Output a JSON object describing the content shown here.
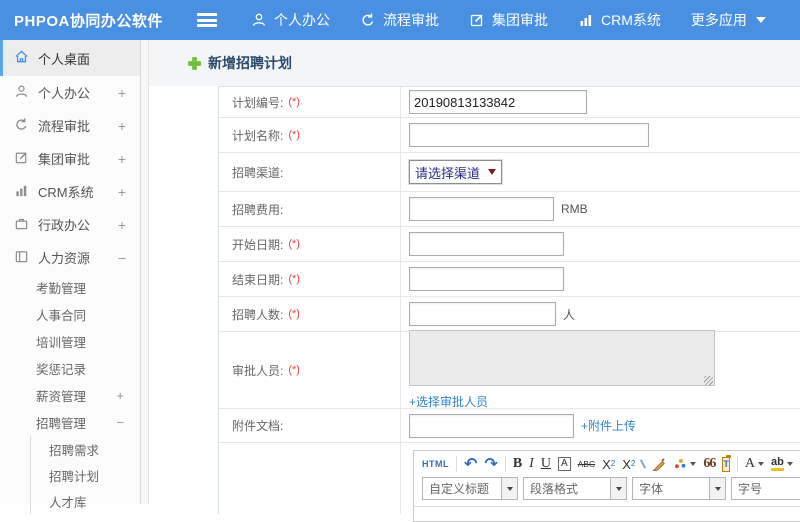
{
  "topbar": {
    "logo": "PHPOA协同办公软件",
    "items": [
      {
        "label": "个人办公",
        "icon": "person-icon"
      },
      {
        "label": "流程审批",
        "icon": "process-icon"
      },
      {
        "label": "集团审批",
        "icon": "edit-icon"
      },
      {
        "label": "CRM系统",
        "icon": "chart-icon"
      },
      {
        "label": "更多应用",
        "icon": "caret-down-icon"
      }
    ]
  },
  "sidebar": {
    "items": [
      {
        "label": "个人桌面",
        "active": true
      },
      {
        "label": "个人办公",
        "expand": "+"
      },
      {
        "label": "流程审批",
        "expand": "+"
      },
      {
        "label": "集团审批",
        "expand": "+"
      },
      {
        "label": "CRM系统",
        "expand": "+"
      },
      {
        "label": "行政办公",
        "expand": "+"
      },
      {
        "label": "人力资源",
        "expand": "−"
      }
    ],
    "submenu": [
      {
        "label": "考勤管理"
      },
      {
        "label": "人事合同"
      },
      {
        "label": "培训管理"
      },
      {
        "label": "奖惩记录"
      },
      {
        "label": "薪资管理",
        "expand": "+"
      },
      {
        "label": "招聘管理",
        "expand": "−"
      }
    ],
    "subsubmenu": [
      {
        "label": "招聘需求"
      },
      {
        "label": "招聘计划"
      },
      {
        "label": "人才库"
      }
    ]
  },
  "main": {
    "title": "新增招聘计划",
    "required_mark": "(*)",
    "form": {
      "plan_no": {
        "label": "计划编号:",
        "value": "20190813133842"
      },
      "plan_name": {
        "label": "计划名称:"
      },
      "channel": {
        "label": "招聘渠道:",
        "selected": "请选择渠道"
      },
      "fee": {
        "label": "招聘费用:",
        "unit": "RMB"
      },
      "start_date": {
        "label": "开始日期:"
      },
      "end_date": {
        "label": "结束日期:"
      },
      "headcount": {
        "label": "招聘人数:",
        "unit": "人"
      },
      "approver": {
        "label": "审批人员:",
        "link": "+选择审批人员"
      },
      "attachment": {
        "label": "附件文档:",
        "link": "+附件上传"
      }
    },
    "editor": {
      "html": "HTML",
      "undo": "↶",
      "redo": "↷",
      "bold": "B",
      "italic": "I",
      "underline": "U",
      "font_box": "A",
      "strike": "ABC",
      "sup_base": "X",
      "sup_exp": "2",
      "sub_base": "X",
      "sub_exp": "2",
      "quote": "66",
      "paste_t": "T",
      "font_color": "A",
      "highlight": "ab",
      "heading_dd": "自定义标题",
      "paragraph_dd": "段落格式",
      "font_dd": "字体",
      "size_dd": "字号"
    }
  },
  "colors": {
    "topbar_blue": "#4a90e2",
    "accent_green": "#6fbd3c",
    "link_blue": "#3585c6",
    "required_red": "#e64545",
    "select_text": "#2d2d86"
  }
}
